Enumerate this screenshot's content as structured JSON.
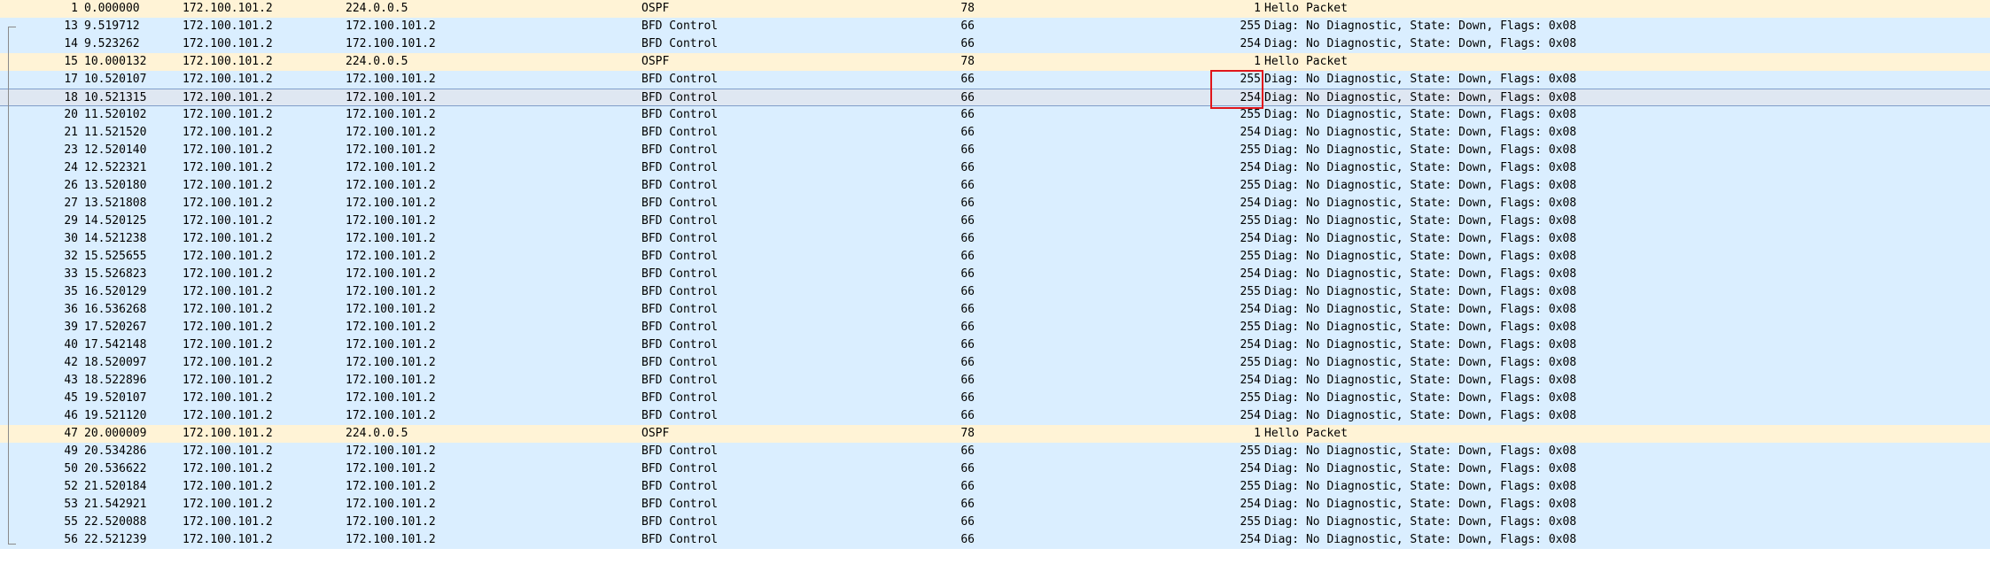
{
  "packets": [
    {
      "no": "1",
      "time": "0.000000",
      "src": "172.100.101.2",
      "dst": "224.0.0.5",
      "proto": "OSPF",
      "len": "78",
      "ttl": "1",
      "info": "Hello Packet",
      "kind": "ospf"
    },
    {
      "no": "13",
      "time": "9.519712",
      "src": "172.100.101.2",
      "dst": "172.100.101.2",
      "proto": "BFD Control",
      "len": "66",
      "ttl": "255",
      "info": "Diag: No Diagnostic, State: Down, Flags: 0x08",
      "kind": "bfd"
    },
    {
      "no": "14",
      "time": "9.523262",
      "src": "172.100.101.2",
      "dst": "172.100.101.2",
      "proto": "BFD Control",
      "len": "66",
      "ttl": "254",
      "info": "Diag: No Diagnostic, State: Down, Flags: 0x08",
      "kind": "bfd"
    },
    {
      "no": "15",
      "time": "10.000132",
      "src": "172.100.101.2",
      "dst": "224.0.0.5",
      "proto": "OSPF",
      "len": "78",
      "ttl": "1",
      "info": "Hello Packet",
      "kind": "ospf"
    },
    {
      "no": "17",
      "time": "10.520107",
      "src": "172.100.101.2",
      "dst": "172.100.101.2",
      "proto": "BFD Control",
      "len": "66",
      "ttl": "255",
      "info": "Diag: No Diagnostic, State: Down, Flags: 0x08",
      "kind": "bfd"
    },
    {
      "no": "18",
      "time": "10.521315",
      "src": "172.100.101.2",
      "dst": "172.100.101.2",
      "proto": "BFD Control",
      "len": "66",
      "ttl": "254",
      "info": "Diag: No Diagnostic, State: Down, Flags: 0x08",
      "kind": "sel"
    },
    {
      "no": "20",
      "time": "11.520102",
      "src": "172.100.101.2",
      "dst": "172.100.101.2",
      "proto": "BFD Control",
      "len": "66",
      "ttl": "255",
      "info": "Diag: No Diagnostic, State: Down, Flags: 0x08",
      "kind": "bfd"
    },
    {
      "no": "21",
      "time": "11.521520",
      "src": "172.100.101.2",
      "dst": "172.100.101.2",
      "proto": "BFD Control",
      "len": "66",
      "ttl": "254",
      "info": "Diag: No Diagnostic, State: Down, Flags: 0x08",
      "kind": "bfd"
    },
    {
      "no": "23",
      "time": "12.520140",
      "src": "172.100.101.2",
      "dst": "172.100.101.2",
      "proto": "BFD Control",
      "len": "66",
      "ttl": "255",
      "info": "Diag: No Diagnostic, State: Down, Flags: 0x08",
      "kind": "bfd"
    },
    {
      "no": "24",
      "time": "12.522321",
      "src": "172.100.101.2",
      "dst": "172.100.101.2",
      "proto": "BFD Control",
      "len": "66",
      "ttl": "254",
      "info": "Diag: No Diagnostic, State: Down, Flags: 0x08",
      "kind": "bfd"
    },
    {
      "no": "26",
      "time": "13.520180",
      "src": "172.100.101.2",
      "dst": "172.100.101.2",
      "proto": "BFD Control",
      "len": "66",
      "ttl": "255",
      "info": "Diag: No Diagnostic, State: Down, Flags: 0x08",
      "kind": "bfd"
    },
    {
      "no": "27",
      "time": "13.521808",
      "src": "172.100.101.2",
      "dst": "172.100.101.2",
      "proto": "BFD Control",
      "len": "66",
      "ttl": "254",
      "info": "Diag: No Diagnostic, State: Down, Flags: 0x08",
      "kind": "bfd"
    },
    {
      "no": "29",
      "time": "14.520125",
      "src": "172.100.101.2",
      "dst": "172.100.101.2",
      "proto": "BFD Control",
      "len": "66",
      "ttl": "255",
      "info": "Diag: No Diagnostic, State: Down, Flags: 0x08",
      "kind": "bfd"
    },
    {
      "no": "30",
      "time": "14.521238",
      "src": "172.100.101.2",
      "dst": "172.100.101.2",
      "proto": "BFD Control",
      "len": "66",
      "ttl": "254",
      "info": "Diag: No Diagnostic, State: Down, Flags: 0x08",
      "kind": "bfd"
    },
    {
      "no": "32",
      "time": "15.525655",
      "src": "172.100.101.2",
      "dst": "172.100.101.2",
      "proto": "BFD Control",
      "len": "66",
      "ttl": "255",
      "info": "Diag: No Diagnostic, State: Down, Flags: 0x08",
      "kind": "bfd"
    },
    {
      "no": "33",
      "time": "15.526823",
      "src": "172.100.101.2",
      "dst": "172.100.101.2",
      "proto": "BFD Control",
      "len": "66",
      "ttl": "254",
      "info": "Diag: No Diagnostic, State: Down, Flags: 0x08",
      "kind": "bfd"
    },
    {
      "no": "35",
      "time": "16.520129",
      "src": "172.100.101.2",
      "dst": "172.100.101.2",
      "proto": "BFD Control",
      "len": "66",
      "ttl": "255",
      "info": "Diag: No Diagnostic, State: Down, Flags: 0x08",
      "kind": "bfd"
    },
    {
      "no": "36",
      "time": "16.536268",
      "src": "172.100.101.2",
      "dst": "172.100.101.2",
      "proto": "BFD Control",
      "len": "66",
      "ttl": "254",
      "info": "Diag: No Diagnostic, State: Down, Flags: 0x08",
      "kind": "bfd"
    },
    {
      "no": "39",
      "time": "17.520267",
      "src": "172.100.101.2",
      "dst": "172.100.101.2",
      "proto": "BFD Control",
      "len": "66",
      "ttl": "255",
      "info": "Diag: No Diagnostic, State: Down, Flags: 0x08",
      "kind": "bfd"
    },
    {
      "no": "40",
      "time": "17.542148",
      "src": "172.100.101.2",
      "dst": "172.100.101.2",
      "proto": "BFD Control",
      "len": "66",
      "ttl": "254",
      "info": "Diag: No Diagnostic, State: Down, Flags: 0x08",
      "kind": "bfd"
    },
    {
      "no": "42",
      "time": "18.520097",
      "src": "172.100.101.2",
      "dst": "172.100.101.2",
      "proto": "BFD Control",
      "len": "66",
      "ttl": "255",
      "info": "Diag: No Diagnostic, State: Down, Flags: 0x08",
      "kind": "bfd"
    },
    {
      "no": "43",
      "time": "18.522896",
      "src": "172.100.101.2",
      "dst": "172.100.101.2",
      "proto": "BFD Control",
      "len": "66",
      "ttl": "254",
      "info": "Diag: No Diagnostic, State: Down, Flags: 0x08",
      "kind": "bfd"
    },
    {
      "no": "45",
      "time": "19.520107",
      "src": "172.100.101.2",
      "dst": "172.100.101.2",
      "proto": "BFD Control",
      "len": "66",
      "ttl": "255",
      "info": "Diag: No Diagnostic, State: Down, Flags: 0x08",
      "kind": "bfd"
    },
    {
      "no": "46",
      "time": "19.521120",
      "src": "172.100.101.2",
      "dst": "172.100.101.2",
      "proto": "BFD Control",
      "len": "66",
      "ttl": "254",
      "info": "Diag: No Diagnostic, State: Down, Flags: 0x08",
      "kind": "bfd"
    },
    {
      "no": "47",
      "time": "20.000009",
      "src": "172.100.101.2",
      "dst": "224.0.0.5",
      "proto": "OSPF",
      "len": "78",
      "ttl": "1",
      "info": "Hello Packet",
      "kind": "ospf"
    },
    {
      "no": "49",
      "time": "20.534286",
      "src": "172.100.101.2",
      "dst": "172.100.101.2",
      "proto": "BFD Control",
      "len": "66",
      "ttl": "255",
      "info": "Diag: No Diagnostic, State: Down, Flags: 0x08",
      "kind": "bfd"
    },
    {
      "no": "50",
      "time": "20.536622",
      "src": "172.100.101.2",
      "dst": "172.100.101.2",
      "proto": "BFD Control",
      "len": "66",
      "ttl": "254",
      "info": "Diag: No Diagnostic, State: Down, Flags: 0x08",
      "kind": "bfd"
    },
    {
      "no": "52",
      "time": "21.520184",
      "src": "172.100.101.2",
      "dst": "172.100.101.2",
      "proto": "BFD Control",
      "len": "66",
      "ttl": "255",
      "info": "Diag: No Diagnostic, State: Down, Flags: 0x08",
      "kind": "bfd"
    },
    {
      "no": "53",
      "time": "21.542921",
      "src": "172.100.101.2",
      "dst": "172.100.101.2",
      "proto": "BFD Control",
      "len": "66",
      "ttl": "254",
      "info": "Diag: No Diagnostic, State: Down, Flags: 0x08",
      "kind": "bfd"
    },
    {
      "no": "55",
      "time": "22.520088",
      "src": "172.100.101.2",
      "dst": "172.100.101.2",
      "proto": "BFD Control",
      "len": "66",
      "ttl": "255",
      "info": "Diag: No Diagnostic, State: Down, Flags: 0x08",
      "kind": "bfd"
    },
    {
      "no": "56",
      "time": "22.521239",
      "src": "172.100.101.2",
      "dst": "172.100.101.2",
      "proto": "BFD Control",
      "len": "66",
      "ttl": "254",
      "info": "Diag: No Diagnostic, State: Down, Flags: 0x08",
      "kind": "bfd"
    }
  ],
  "colors": {
    "bfd_row": "#daeeff",
    "ospf_row": "#fff3d6",
    "selected_row": "#dfe7f2",
    "highlight_box": "#e0161b"
  }
}
